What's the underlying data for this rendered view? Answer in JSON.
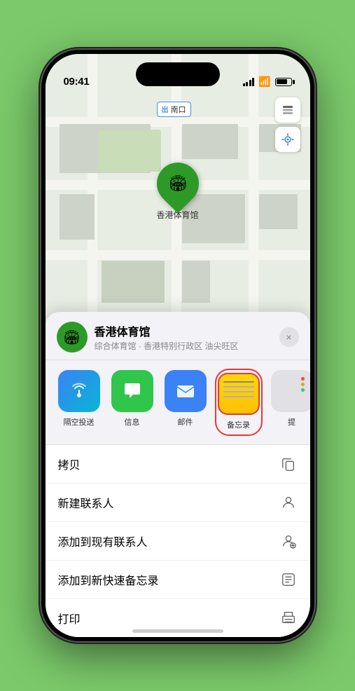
{
  "status_bar": {
    "time": "09:41",
    "location_arrow": "▶"
  },
  "map": {
    "label": "南口",
    "location_name": "香港体育馆",
    "pin_emoji": "🏟"
  },
  "venue": {
    "name": "香港体育馆",
    "description": "综合体育馆 · 香港特别行政区 油尖旺区",
    "logo_emoji": "🏟"
  },
  "share_items": [
    {
      "id": "airdrop",
      "label": "隔空投送",
      "emoji": "📡"
    },
    {
      "id": "messages",
      "label": "信息",
      "emoji": "💬"
    },
    {
      "id": "mail",
      "label": "邮件",
      "emoji": "✉"
    },
    {
      "id": "notes",
      "label": "备忘录"
    },
    {
      "id": "more",
      "label": "提"
    }
  ],
  "actions": [
    {
      "id": "copy",
      "label": "拷贝"
    },
    {
      "id": "new-contact",
      "label": "新建联系人"
    },
    {
      "id": "add-contact",
      "label": "添加到现有联系人"
    },
    {
      "id": "quick-note",
      "label": "添加到新快速备忘录"
    },
    {
      "id": "print",
      "label": "打印"
    }
  ],
  "close_label": "×"
}
